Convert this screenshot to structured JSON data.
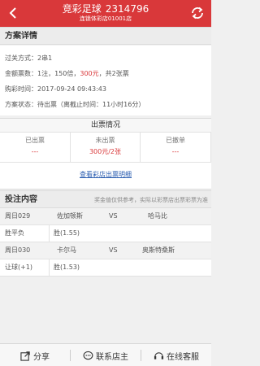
{
  "header": {
    "title": "竞彩足球",
    "id": "2314796",
    "subtitle": "连锁体彩店01001店"
  },
  "detail": {
    "section_title": "方案详情",
    "pass_type": "过关方式：2串1",
    "amount_prefix": "金额票数：1注，150倍，",
    "amount_value": "300元",
    "amount_suffix": "，共2张票",
    "buy_time": "购彩时间：2017-09-24 09:43:43",
    "status_prefix": "方案状态：待出票（离截止时间：11小时16分）"
  },
  "ticket": {
    "title": "出票情况",
    "cols": [
      {
        "label": "已出票",
        "value": "---"
      },
      {
        "label": "未出票",
        "value": "300元/2张"
      },
      {
        "label": "已撤单",
        "value": "---"
      }
    ],
    "link": "查看彩店出票明细"
  },
  "bet": {
    "section_title": "投注内容",
    "note": "奖金值仅供参考，实际以彩票店出票彩票为准",
    "matches": [
      {
        "code": "周日029",
        "home": "佐加顿斯",
        "vs": "VS",
        "away": "哈马比",
        "play": "胜平负",
        "pick": "胜(1.55)"
      },
      {
        "code": "周日030",
        "home": "卡尔马",
        "vs": "VS",
        "away": "奥斯特桑斯",
        "play": "让球(+1)",
        "pick": "胜(1.53)"
      }
    ]
  },
  "bottom": {
    "share": "分享",
    "contact": "联系店主",
    "service": "在线客服"
  },
  "colors": {
    "primary": "#d9383a",
    "link": "#2a5db0"
  }
}
